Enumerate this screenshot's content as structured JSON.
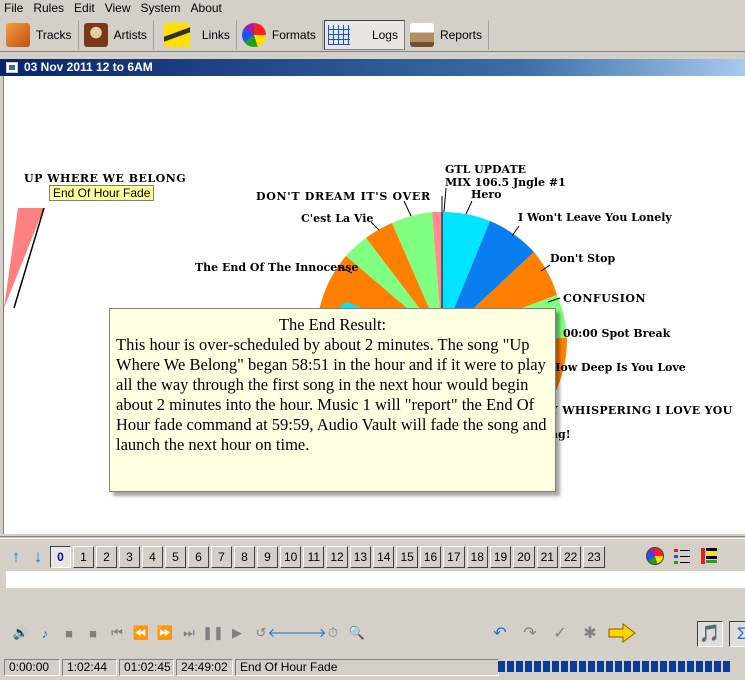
{
  "menu": [
    "File",
    "Rules",
    "Edit",
    "View",
    "System",
    "About"
  ],
  "toolbar": {
    "buttons": [
      {
        "label": "Tracks",
        "icon": "tracks-icon",
        "color": "#e07a1f"
      },
      {
        "label": "Artists",
        "icon": "artist-portrait-icon",
        "color": "#8a4a2a"
      },
      {
        "label": "Links",
        "icon": "links-icon",
        "color": "#c8b400"
      },
      {
        "label": "Formats",
        "icon": "formats-pie-icon",
        "color": "#2050d0"
      },
      {
        "label": "Logs",
        "icon": "logs-grid-icon",
        "color": "#2050b0"
      },
      {
        "label": "Reports",
        "icon": "reports-printer-icon",
        "color": "#806030"
      }
    ]
  },
  "window": {
    "title": "03 Nov 2011 12 to 6AM"
  },
  "clock": {
    "left": {
      "title": "UP WHERE WE BELONG",
      "fade": "End Of Hour Fade"
    },
    "labels": [
      "GTL UPDATE",
      "MIX 106.5 Jngle #1",
      "Hero",
      "I Won't Leave You Lonely",
      "Don't Stop",
      "CONFUSION",
      "00:00 Spot Break",
      "How Deep Is You Love",
      "Y WHISPERING I LOVE YOU",
      "ng!",
      "DON'T DREAM IT'S OVER",
      "C'est La Vie",
      "The End Of The Innocense"
    ],
    "colors": {
      "cyan": "#00e5ff",
      "blue": "#0a7ef0",
      "orange": "#ff8000",
      "green": "#80ff80",
      "pink": "#ff8080",
      "pinkpale": "#ff9090"
    }
  },
  "note": {
    "title": "The End Result:",
    "body": "This hour is over-scheduled by about 2 minutes.  The song \"Up Where We Belong\" began 58:51 in the hour and if it were to play all the way through the first song in the next hour would begin about 2 minutes into the hour.  Music 1 will \"report\" the End Of Hour fade command at 59:59, Audio Vault will fade the song and launch the next hour on time."
  },
  "hours": [
    "0",
    "1",
    "2",
    "3",
    "4",
    "5",
    "6",
    "7",
    "8",
    "9",
    "10",
    "11",
    "12",
    "13",
    "14",
    "15",
    "16",
    "17",
    "18",
    "19",
    "20",
    "21",
    "22",
    "23"
  ],
  "selected_hour": "0",
  "status": {
    "elapsed": "0:00:00",
    "length": "1:02:44",
    "total": "01:02:45",
    "clock": "24:49:02",
    "current": "End Of Hour Fade"
  },
  "progress_fraction": 0.97
}
